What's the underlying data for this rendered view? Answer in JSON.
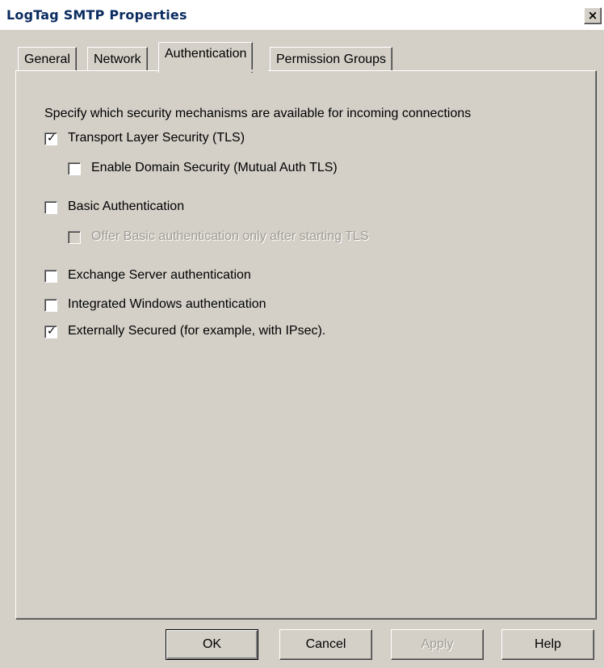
{
  "window": {
    "title": "LogTag SMTP Properties",
    "close_label": "×"
  },
  "tabs": [
    {
      "label": "General",
      "active": false
    },
    {
      "label": "Network",
      "active": false
    },
    {
      "label": "Authentication",
      "active": true
    },
    {
      "label": "Permission Groups",
      "active": false
    }
  ],
  "content": {
    "intro": "Specify which security mechanisms are available for incoming connections",
    "options": [
      {
        "label": "Transport Layer Security (TLS)",
        "checked": true,
        "enabled": true
      },
      {
        "label": "Enable Domain Security (Mutual Auth TLS)",
        "checked": false,
        "enabled": true
      },
      {
        "label": "Basic Authentication",
        "checked": false,
        "enabled": true
      },
      {
        "label": "Offer Basic authentication only after starting TLS",
        "checked": false,
        "enabled": false
      },
      {
        "label": "Exchange Server authentication",
        "checked": false,
        "enabled": true
      },
      {
        "label": "Integrated Windows authentication",
        "checked": false,
        "enabled": true
      },
      {
        "label": "Externally Secured (for example, with IPsec).",
        "checked": true,
        "enabled": true
      }
    ],
    "check_glyph": "✓"
  },
  "buttons": {
    "ok": "OK",
    "cancel": "Cancel",
    "apply": "Apply",
    "help": "Help"
  }
}
